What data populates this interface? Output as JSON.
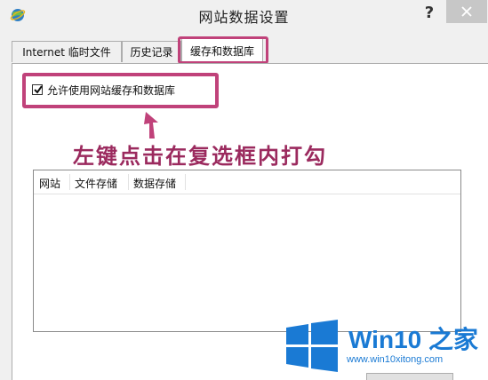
{
  "window": {
    "title": "网站数据设置",
    "help_label": "?"
  },
  "tabs": [
    {
      "label": "Internet 临时文件"
    },
    {
      "label": "历史记录"
    },
    {
      "label": "缓存和数据库"
    }
  ],
  "settings": {
    "allow_cache_label": "允许使用网站缓存和数据库",
    "allow_cache_checked": true
  },
  "annotation": {
    "text": "左键点击在复选框内打勾"
  },
  "list": {
    "columns": [
      "网站",
      "文件存储",
      "数据存储"
    ]
  },
  "watermark": {
    "title": "Win10 之家",
    "url": "www.win10xitong.com"
  },
  "colors": {
    "highlight": "#c0427a",
    "annotation": "#9b2a5e",
    "watermark": "#1a7ad4"
  }
}
